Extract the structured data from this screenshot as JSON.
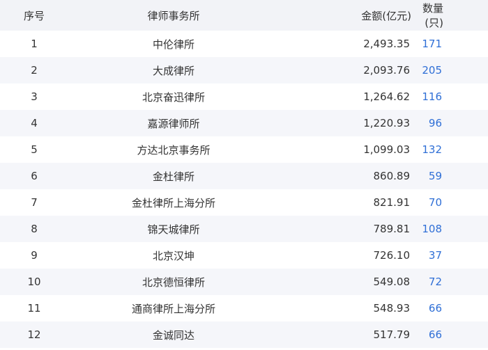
{
  "table": {
    "headers": {
      "index": "序号",
      "firm": "律师事务所",
      "amount": "金额(亿元)",
      "count": "数量(只)"
    },
    "rows": [
      {
        "index": "1",
        "firm": "中伦律所",
        "amount": "2,493.35",
        "count": "171"
      },
      {
        "index": "2",
        "firm": "大成律所",
        "amount": "2,093.76",
        "count": "205"
      },
      {
        "index": "3",
        "firm": "北京奋迅律所",
        "amount": "1,264.62",
        "count": "116"
      },
      {
        "index": "4",
        "firm": "嘉源律师所",
        "amount": "1,220.93",
        "count": "96"
      },
      {
        "index": "5",
        "firm": "方达北京事务所",
        "amount": "1,099.03",
        "count": "132"
      },
      {
        "index": "6",
        "firm": "金杜律所",
        "amount": "860.89",
        "count": "59"
      },
      {
        "index": "7",
        "firm": "金杜律所上海分所",
        "amount": "821.91",
        "count": "70"
      },
      {
        "index": "8",
        "firm": "锦天城律所",
        "amount": "789.81",
        "count": "108"
      },
      {
        "index": "9",
        "firm": "北京汉坤",
        "amount": "726.10",
        "count": "37"
      },
      {
        "index": "10",
        "firm": "北京德恒律所",
        "amount": "549.08",
        "count": "72"
      },
      {
        "index": "11",
        "firm": "通商律所上海分所",
        "amount": "548.93",
        "count": "66"
      },
      {
        "index": "12",
        "firm": "金诚同达",
        "amount": "517.79",
        "count": "66"
      }
    ]
  },
  "colors": {
    "header_bg": "#f2f3f7",
    "stripe_bg": "#f5f6fa",
    "link": "#2f6fd6",
    "text": "#333333"
  }
}
